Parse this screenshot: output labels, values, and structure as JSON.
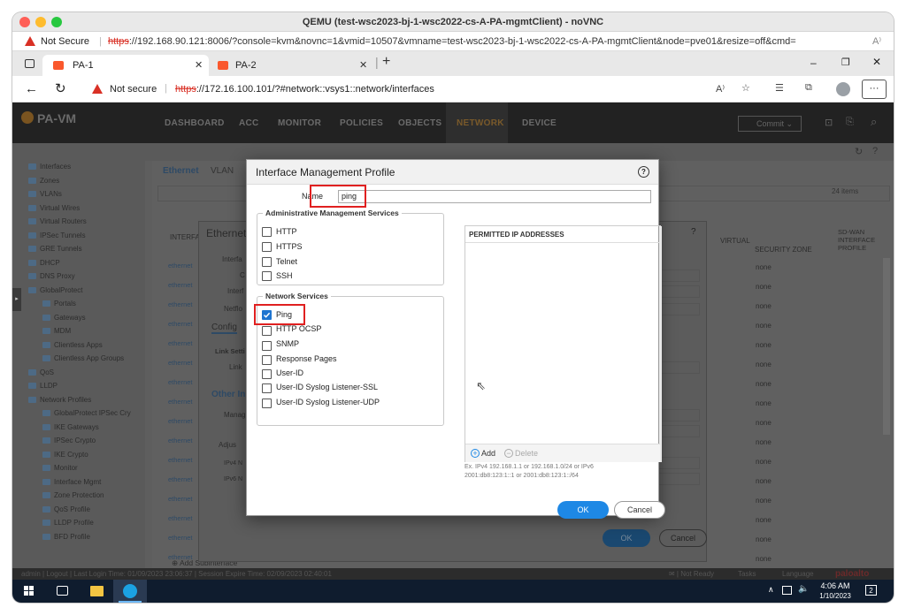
{
  "mac_window": {
    "title": "QEMU (test-wsc2023-bj-1-wsc2022-cs-A-PA-mgmtClient) - noVNC"
  },
  "novnc_url": {
    "warning": "Not Secure",
    "scheme": "https",
    "rest": "://192.168.90.121:8006/?console=kvm&novnc=1&vmid=10507&vmname=test-wsc2023-bj-1-wsc2022-cs-A-PA-mgmtClient&node=pve01&resize=off&cmd="
  },
  "edge": {
    "tabs": [
      {
        "label": "PA-1"
      },
      {
        "label": "PA-2"
      }
    ],
    "address": {
      "warning": "Not secure",
      "scheme": "https",
      "rest": "://172.16.100.101/?#network::vsys1::network/interfaces"
    }
  },
  "panos": {
    "logo": "PA-VM",
    "nav": [
      "DASHBOARD",
      "ACC",
      "MONITOR",
      "POLICIES",
      "OBJECTS",
      "NETWORK",
      "DEVICE"
    ],
    "commit_label": "Commit",
    "sidebar": [
      "Interfaces",
      "Zones",
      "VLANs",
      "Virtual Wires",
      "Virtual Routers",
      "IPSec Tunnels",
      "GRE Tunnels",
      "DHCP",
      "DNS Proxy",
      "GlobalProtect",
      "Portals",
      "Gateways",
      "MDM",
      "Clientless Apps",
      "Clientless App Groups",
      "QoS",
      "LLDP",
      "Network Profiles",
      "GlobalProtect IPSec Cry",
      "IKE Gateways",
      "IPSec Crypto",
      "IKE Crypto",
      "Monitor",
      "Interface Mgmt",
      "Zone Protection",
      "QoS Profile",
      "LLDP Profile",
      "BFD Profile"
    ],
    "content_tabs": [
      "Ethernet",
      "VLAN"
    ],
    "items_count": "24 items",
    "columns": [
      "INTERFACE",
      "VIRTUAL",
      "SECURITY ZONE",
      "SD-WAN INTERFACE PROFILE"
    ],
    "rows_iface": "ethernet",
    "zone_value": "none",
    "status_bar": "admin | Logout | Last Login Time: 01/09/2023 23:06:37 | Session Expire Time: 02/09/2023 02:40:01",
    "status_right": {
      "tasks": "Tasks",
      "language": "Language",
      "notready": "Not Ready"
    },
    "brand": "paloalto"
  },
  "bg_dialog": {
    "title": "Ethernet",
    "field_labels": [
      "Interfa",
      "C",
      "Interf",
      "Netflo"
    ],
    "config_tab": "Config",
    "link_settings": "Link Setti",
    "link": "Link",
    "other_info": "Other In",
    "manage": "Manag",
    "adjust": "Adjus",
    "ipv4": "IPv4 N",
    "ipv6": "IPv6 N",
    "ok": "OK",
    "cancel": "Cancel",
    "add_sub": "Add Subinterface"
  },
  "modal": {
    "title": "Interface Management Profile",
    "name_label": "Name",
    "name_value": "ping",
    "admin_legend": "Administrative Management Services",
    "admin_services": [
      {
        "label": "HTTP",
        "checked": false
      },
      {
        "label": "HTTPS",
        "checked": false
      },
      {
        "label": "Telnet",
        "checked": false
      },
      {
        "label": "SSH",
        "checked": false
      }
    ],
    "network_legend": "Network Services",
    "network_services": [
      {
        "label": "Ping",
        "checked": true
      },
      {
        "label": "HTTP OCSP",
        "checked": false
      },
      {
        "label": "SNMP",
        "checked": false
      },
      {
        "label": "Response Pages",
        "checked": false
      },
      {
        "label": "User-ID",
        "checked": false
      },
      {
        "label": "User-ID Syslog Listener-SSL",
        "checked": false
      },
      {
        "label": "User-ID Syslog Listener-UDP",
        "checked": false
      }
    ],
    "permitted_header": "PERMITTED IP ADDRESSES",
    "add_label": "Add",
    "delete_label": "Delete",
    "hint_line1": "Ex. IPv4 192.168.1.1 or 192.168.1.0/24 or IPv6",
    "hint_line2": "2001:db8:123:1::1 or 2001:db8:123:1::/64",
    "ok_label": "OK",
    "cancel_label": "Cancel"
  },
  "taskbar": {
    "time": "4:06 AM",
    "date": "1/10/2023",
    "notif_count": "2"
  },
  "colors": {
    "accent": "#1e88e5",
    "highlight": "#e02020",
    "pa_orange": "#f28c28"
  }
}
